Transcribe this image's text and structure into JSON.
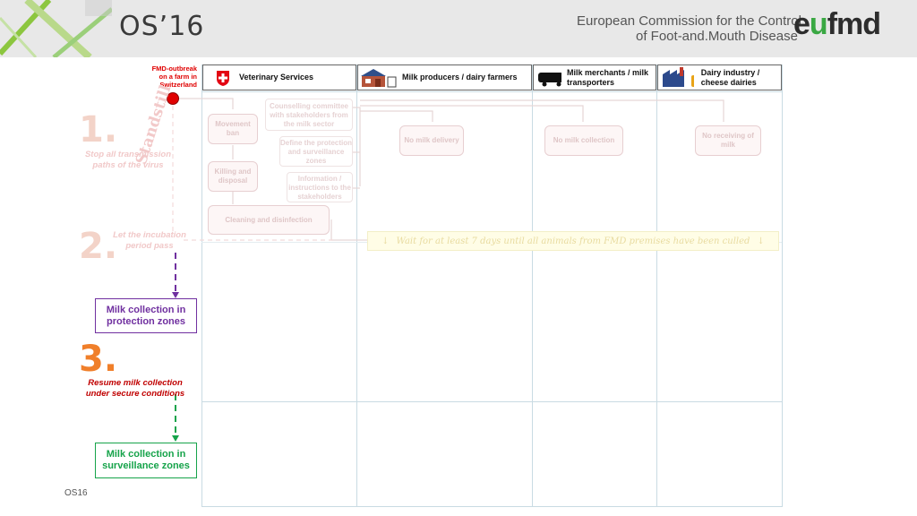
{
  "header": {
    "title": "OS’16",
    "commission_line1": "European Commission for the Control",
    "commission_line2": "of Foot-and.Mouth Disease",
    "logo_prefix": "e",
    "logo_mid": "u",
    "logo_suffix": "fmd"
  },
  "outbreak_note": "FMD-outbreak on a farm in Switzerland",
  "columns": [
    {
      "label": "Veterinary Services",
      "icon": "swiss-flag-icon"
    },
    {
      "label": "Milk producers / dairy farmers",
      "icon": "farm-icon"
    },
    {
      "label": "Milk merchants / milk transporters",
      "icon": "truck-icon"
    },
    {
      "label": "Dairy industry / cheese dairies",
      "icon": "factory-icon"
    }
  ],
  "standstill_label": "Standstill",
  "steps": [
    {
      "number": "1.",
      "text": "Stop all transmission paths of the virus"
    },
    {
      "number": "2.",
      "text": "Let the incubation period pass"
    },
    {
      "number": "3.",
      "text": "Resume milk collection under secure conditions"
    }
  ],
  "vet_boxes": {
    "movement_ban": "Movement ban",
    "killing": "Killing and disposal",
    "cleaning": "Cleaning and disinfection"
  },
  "vet_texts": {
    "counselling": "Counselling committee with stakeholders from the milk sector",
    "define_zones": "Define the protection and surveillance zones",
    "information": "Information / instructions to the stakeholders"
  },
  "action_boxes": {
    "no_delivery": "No milk delivery",
    "no_collection": "No milk collection",
    "no_receiving": "No receiving of milk"
  },
  "wait_banner": "Wait for at least 7 days until all animals from FMD premises have been culled",
  "zones": {
    "protection": "Milk collection in protection zones",
    "surveillance": "Milk collection in surveillance zones"
  },
  "footer": "OS16",
  "colors": {
    "header_bg": "#e8e8e8",
    "outbreak_red": "#e00000",
    "protection_purple": "#7030a0",
    "surveillance_green": "#16a34a",
    "step3_orange": "#f07f2a",
    "step3_text_red": "#c00000",
    "wait_banner": "#fffde6"
  }
}
